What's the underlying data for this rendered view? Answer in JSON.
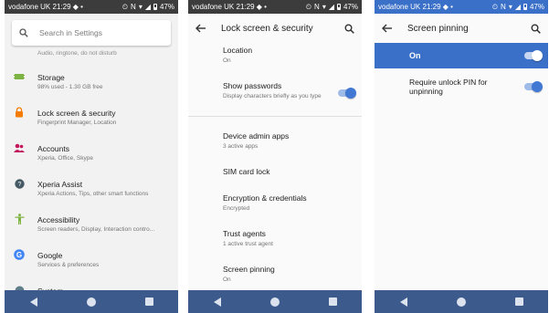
{
  "status_bar": {
    "carrier": "vodafone UK",
    "time": "21:29",
    "battery": "47%"
  },
  "panel1": {
    "search_placeholder": "Search in Settings",
    "cutoff_text": "Audio, ringtone, do not disturb",
    "items": [
      {
        "title": "Storage",
        "subtitle": "98% used - 1.30 GB free",
        "icon": "storage-icon",
        "color": "#7cb342"
      },
      {
        "title": "Lock screen & security",
        "subtitle": "Fingerprint Manager, Location",
        "icon": "lock-icon",
        "color": "#f57c00"
      },
      {
        "title": "Accounts",
        "subtitle": "Xperia, Office, Skype",
        "icon": "accounts-icon",
        "color": "#c2185b"
      },
      {
        "title": "Xperia Assist",
        "subtitle": "Xperia Actions, Tips, other smart functions",
        "icon": "assist-icon",
        "color": "#455a64"
      },
      {
        "title": "Accessibility",
        "subtitle": "Screen readers, Display, Interaction contro...",
        "icon": "accessibility-icon",
        "color": "#7cb342"
      },
      {
        "title": "Google",
        "subtitle": "Services & preferences",
        "icon": "google-icon",
        "color": "#4285f4"
      },
      {
        "title": "System",
        "subtitle": "",
        "icon": "system-icon",
        "color": "#607d8b"
      }
    ]
  },
  "panel2": {
    "title": "Lock screen & security",
    "items": [
      {
        "title": "Location",
        "subtitle": "On"
      },
      {
        "title": "Show passwords",
        "subtitle": "Display characters briefly as you type",
        "toggle": true
      },
      {
        "title": "Device admin apps",
        "subtitle": "3 active apps"
      },
      {
        "title": "SIM card lock",
        "subtitle": ""
      },
      {
        "title": "Encryption & credentials",
        "subtitle": "Encrypted"
      },
      {
        "title": "Trust agents",
        "subtitle": "1 active trust agent"
      },
      {
        "title": "Screen pinning",
        "subtitle": "On"
      }
    ]
  },
  "panel3": {
    "title": "Screen pinning",
    "master_label": "On",
    "require_pin_label": "Require unlock PIN for unpinning"
  },
  "colors": {
    "accent": "#3b70c9",
    "toggle_on": "#4178d4"
  }
}
